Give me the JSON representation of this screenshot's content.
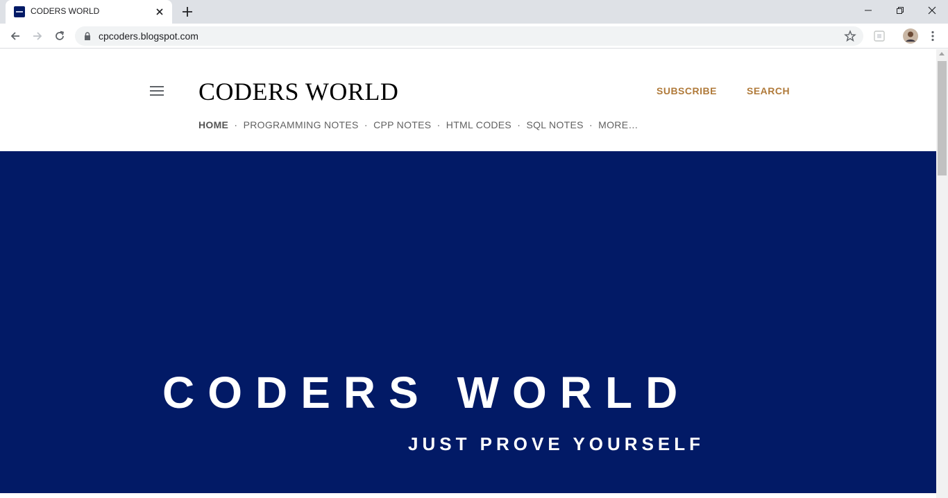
{
  "browser": {
    "tab": {
      "title": "CODERS WORLD",
      "favicon": "site-favicon"
    },
    "url": "cpcoders.blogspot.com"
  },
  "header": {
    "title": "CODERS WORLD",
    "subscribe_label": "SUBSCRIBE",
    "search_label": "SEARCH",
    "nav": {
      "home": "HOME",
      "items": [
        "PROGRAMMING NOTES",
        "CPP NOTES",
        "HTML CODES",
        "SQL NOTES",
        "MORE…"
      ],
      "separator": "·"
    }
  },
  "hero": {
    "title": "CODERS WORLD",
    "subtitle": "JUST PROVE YOURSELF",
    "background": "#021a66"
  },
  "colors": {
    "accent": "#b07a3a",
    "tabstrip": "#dee1e6"
  },
  "icons": [
    "back-icon",
    "forward-icon",
    "reload-icon",
    "lock-icon",
    "star-icon",
    "extension-icon",
    "avatar",
    "more-icon",
    "hamburger-icon"
  ]
}
